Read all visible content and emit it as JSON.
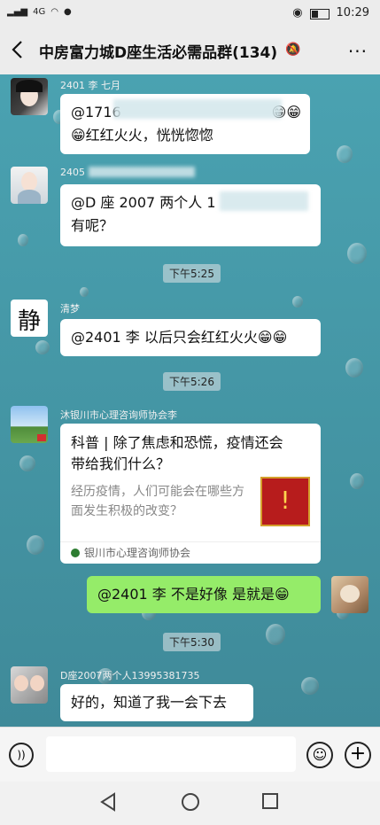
{
  "status": {
    "time": "10:29",
    "signal": "4G"
  },
  "header": {
    "title": "中房富力城D座生活必需品群(134)",
    "more": "···"
  },
  "messages": [
    {
      "nick": "2401 李 七月",
      "text_line1": "@1716",
      "text_line2": "😁红红火火，恍恍惚惚",
      "emoji_end": "😁😁"
    },
    {
      "nick": "2405",
      "text_line1": "@D 座 2007 两个人 1",
      "text_line2": "有呢？"
    },
    {
      "time": "下午5:25"
    },
    {
      "nick": "清梦",
      "text": "@2401 李  以后只会红红火火😁😁"
    },
    {
      "time": "下午5:26"
    },
    {
      "nick": "沐银川市心理咨询师协会李",
      "card_title": "科普 | 除了焦虑和恐慌，疫情还会带给我们什么？",
      "card_desc": "经历疫情，人们可能会在哪些方面发生积极的改变？",
      "card_source": "银川市心理咨询师协会"
    },
    {
      "me": true,
      "text": "@2401 李  不是好像 是就是😁"
    },
    {
      "time": "下午5:30"
    },
    {
      "nick": "D座2007两个人13995381735",
      "text": "好的，知道了我一会下去"
    }
  ]
}
